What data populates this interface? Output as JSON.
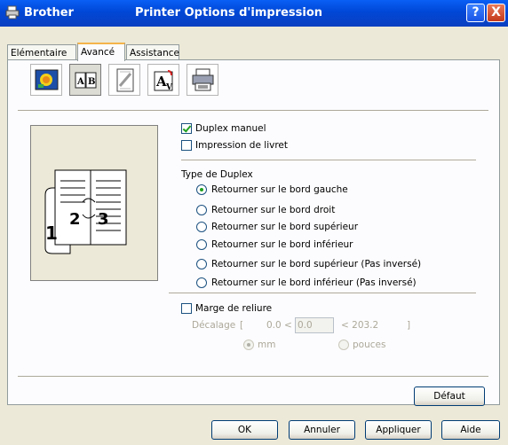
{
  "titlebar": {
    "app_name": "Brother",
    "title": "Printer Options d'impression",
    "help_glyph": "?",
    "close_glyph": "X"
  },
  "tabs": [
    {
      "label": "Elémentaire",
      "active": false
    },
    {
      "label": "Avancé",
      "active": true
    },
    {
      "label": "Assistance",
      "active": false
    }
  ],
  "toolbar": {
    "icons": [
      "print-quality-icon",
      "duplex-icon",
      "watermark-icon",
      "page-setting-icon",
      "device-options-icon"
    ],
    "active_index": 1
  },
  "options": {
    "duplex_manuel": {
      "label": "Duplex manuel",
      "checked": true
    },
    "livret": {
      "label": "Impression de livret",
      "checked": false
    }
  },
  "duplex_type": {
    "heading": "Type de Duplex",
    "choices": [
      {
        "label": "Retourner sur le bord gauche",
        "checked": true
      },
      {
        "label": "Retourner sur le bord droit",
        "checked": false
      },
      {
        "label": "Retourner sur le bord supérieur",
        "checked": false
      },
      {
        "label": "Retourner sur le bord inférieur",
        "checked": false
      },
      {
        "label": "Retourner sur le bord supérieur (Pas inversé)",
        "checked": false
      },
      {
        "label": "Retourner sur le bord inférieur (Pas inversé)",
        "checked": false
      }
    ]
  },
  "binding": {
    "label": "Marge de reliure",
    "checked": false,
    "offset_label": "Décalage",
    "bracket_open": "[",
    "min_text": "0.0 <",
    "value": "0.0",
    "max_text": "< 203.2",
    "bracket_close": "]",
    "unit_mm": "mm",
    "unit_inch": "pouces",
    "unit_selected": "mm"
  },
  "preview": {
    "page_numbers": [
      "1",
      "2",
      "3"
    ]
  },
  "buttons": {
    "default": "Défaut",
    "ok": "OK",
    "cancel": "Annuler",
    "apply": "Appliquer",
    "help": "Aide"
  },
  "colors": {
    "titlebar": "#0047d6",
    "check_mark": "#21a121",
    "tab_highlight": "#f5b44a",
    "window_bg": "#ece9d8"
  }
}
